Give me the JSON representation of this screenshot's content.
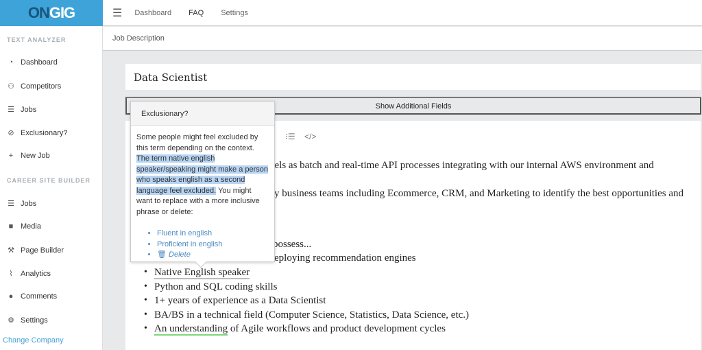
{
  "logo": {
    "part1": "ON",
    "part2": "GIG"
  },
  "topnav": {
    "items": [
      "Dashboard",
      "FAQ",
      "Settings"
    ]
  },
  "breadcrumb": "Job Description",
  "sidebar": {
    "section1": "TEXT ANALYZER",
    "items1": [
      {
        "label": "Dashboard",
        "icon": "tachometer-icon"
      },
      {
        "label": "Competitors",
        "icon": "users-icon"
      },
      {
        "label": "Jobs",
        "icon": "list-icon"
      },
      {
        "label": "Exclusionary?",
        "icon": "ban-icon"
      },
      {
        "label": "New Job",
        "icon": "plus-icon"
      }
    ],
    "section2": "CAREER SITE BUILDER",
    "items2": [
      {
        "label": "Jobs",
        "icon": "list-icon"
      },
      {
        "label": "Media",
        "icon": "video-icon"
      },
      {
        "label": "Page Builder",
        "icon": "hammer-icon"
      },
      {
        "label": "Analytics",
        "icon": "chart-icon"
      },
      {
        "label": "Comments",
        "icon": "comment-icon"
      },
      {
        "label": "Settings",
        "icon": "gear-icon"
      }
    ],
    "change_company": "Change Company"
  },
  "job_title": "Data Scientist",
  "show_fields": "Show Additional Fields",
  "editor": {
    "fragments": [
      "dels as batch and real-time API processes integrating with our internal AWS environment and",
      "y business teams including Ecommerce, CRM, and Marketing to identify the best opportunities and",
      "possess...",
      "eploying recommendation engines"
    ],
    "bullets": [
      "Native English speaker",
      "Python and SQL coding skills",
      "1+ years of experience as a Data Scientist",
      "BA/BS in a technical field (Computer Science, Statistics, Data Science, etc.)",
      "An understanding"
    ],
    "last_bullet_rest": " of Agile workflows and product development cycles"
  },
  "popover": {
    "title": "Exclusionary?",
    "intro": "Some people might feel excluded by this term depending on the context. ",
    "highlight": "The term native english speaker/speaking might make a person who speaks english as a second language feel excluded.",
    "outro": " You might want to replace with a more inclusive phrase or delete:",
    "suggestions": [
      "Fluent in english",
      "Proficient in english"
    ],
    "delete": "Delete"
  },
  "colors": {
    "brand": "#3ea3d8",
    "link": "#4a89c4",
    "highlight": "#b7d4f3"
  }
}
